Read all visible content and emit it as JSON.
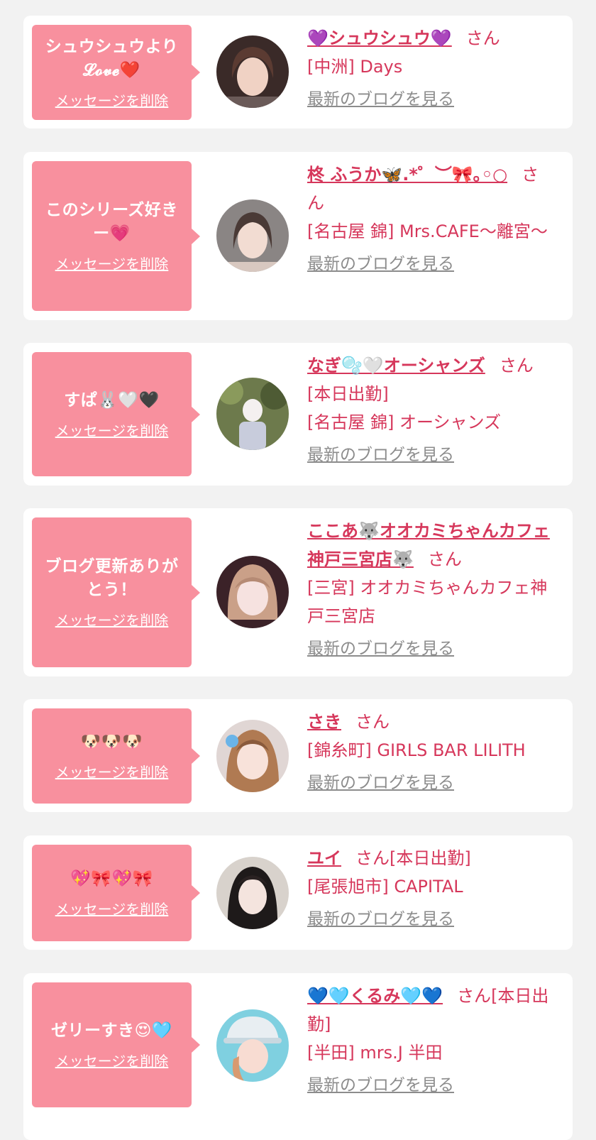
{
  "delete_label": "メッセージを削除",
  "blog_label": "最新のブログを見る",
  "san_label": "さん",
  "cards": [
    {
      "message": "シュウシュウより𝓛𝓸𝓿𝓮❤️",
      "name": "💜シュウシュウ💜",
      "status": "",
      "shop": "[中洲] Days",
      "avatar": "woman-portrait-icon"
    },
    {
      "message": "このシリーズ好きー💗",
      "name": "柊 ふうか🦋.*゜︶🎀｡◦○",
      "status": "",
      "shop": "[名古屋 錦] Mrs.CAFE～離宮～",
      "avatar": "woman-portrait-icon"
    },
    {
      "message": "すぱ🐰🤍🖤",
      "name": "なぎ🫧🤍オーシャンズ",
      "status": "[本日出勤]",
      "shop": "[名古屋 錦] オーシャンズ",
      "avatar": "woman-outdoor-icon"
    },
    {
      "message": "ブログ更新ありがとう！",
      "name": "ここあ🐺オオカミちゃんカフェ神戸三宮店🐺",
      "status": "",
      "shop": "[三宮] オオカミちゃんカフェ神戸三宮店",
      "avatar": "woman-portrait-icon"
    },
    {
      "message": "🐶🐶🐶",
      "name": "さき",
      "status": "",
      "shop": "[錦糸町] GIRLS BAR LILITH",
      "avatar": "woman-portrait-icon"
    },
    {
      "message": "💖🎀💖🎀",
      "name": "ユイ",
      "status": "[本日出勤]",
      "shop": "[尾張旭市] CAPITAL",
      "avatar": "woman-portrait-icon"
    },
    {
      "message": "ゼリーすき😍🩵",
      "name": "💙🩵くるみ🩵💙",
      "status": "[本日出勤]",
      "shop": "[半田] mrs.J 半田",
      "avatar": "woman-cap-icon"
    }
  ],
  "colors": {
    "accent": "#d6375b",
    "bubble": "#f8909e",
    "link_gray": "#8c8c8c",
    "background": "#f2f2f2"
  }
}
